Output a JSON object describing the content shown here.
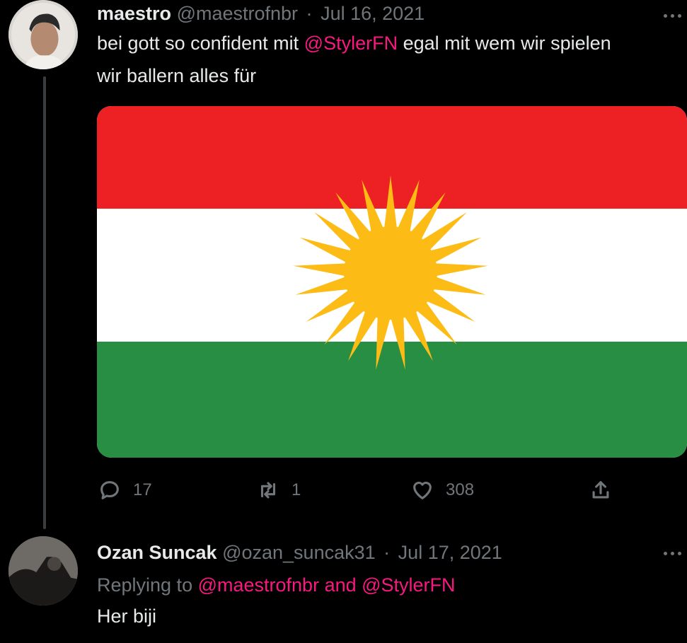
{
  "tweet": {
    "display_name": "maestro",
    "handle": "@maestrofnbr",
    "separator": "·",
    "date": "Jul 16, 2021",
    "text_line1_before": "bei gott so confident mit ",
    "text_line1_mention": "@StylerFN",
    "text_line1_after": " egal mit wem wir spielen",
    "text_line2": "wir ballern alles für",
    "media_icon": "kurdistan-flag",
    "actions": {
      "reply_count": "17",
      "retweet_count": "1",
      "like_count": "308"
    }
  },
  "reply": {
    "display_name": "Ozan Suncak",
    "handle": "@ozan_suncak31",
    "separator": "·",
    "date": "Jul 17, 2021",
    "replying_prefix": "Replying to ",
    "replying_mention1": "@maestrofnbr",
    "replying_and": " and ",
    "replying_mention2": "@StylerFN",
    "text": "Her biji"
  },
  "colors": {
    "background": "#000000",
    "mention": "#f91880",
    "muted": "#71767b",
    "text": "#e7e9ea",
    "flag_red": "#ed2024",
    "flag_white": "#ffffff",
    "flag_green": "#278e43",
    "flag_sun": "#fcbc15"
  }
}
